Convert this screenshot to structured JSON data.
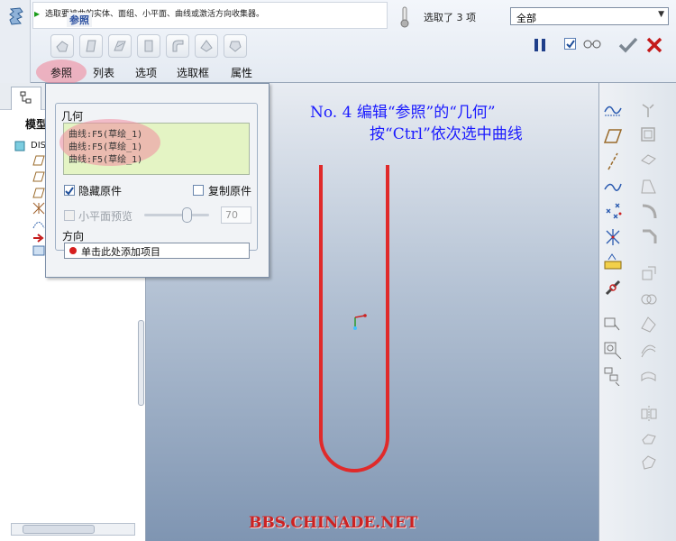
{
  "message": "选取要被曲的实体、面组、小平面、曲线或激活方向收集器。",
  "selection": {
    "count_text": "选取了 3 项",
    "filter_value": "全部"
  },
  "tabs": [
    "参照",
    "列表",
    "选项",
    "选取框",
    "属性"
  ],
  "tree": {
    "title": "模型",
    "rows": [
      "DIS"
    ]
  },
  "references_panel": {
    "group_title": "参照",
    "geometry_label": "几何",
    "geometry_items": [
      "曲线:F5(草绘_1)",
      "曲线:F5(草绘_1)",
      "曲线:F5(草绘_1)"
    ],
    "hide_original_label": "隐藏原件",
    "hide_original_checked": true,
    "copy_original_label": "复制原件",
    "copy_original_checked": false,
    "facet_preview_label": "小平面预览",
    "facet_preview_checked": false,
    "facet_value": "70",
    "direction_label": "方向",
    "direction_placeholder": "单击此处添加项目"
  },
  "annotation": {
    "line1": "No. 4 编辑“参照”的“几何”",
    "line2": "按“Ctrl”依次选中曲线"
  },
  "watermark": "BBS.CHINADE.NET",
  "colors": {
    "curve": "#e02a2a",
    "annotation": "#1a1aff",
    "geometry_box": "#e4f4c4",
    "highlight": "#f08296"
  }
}
